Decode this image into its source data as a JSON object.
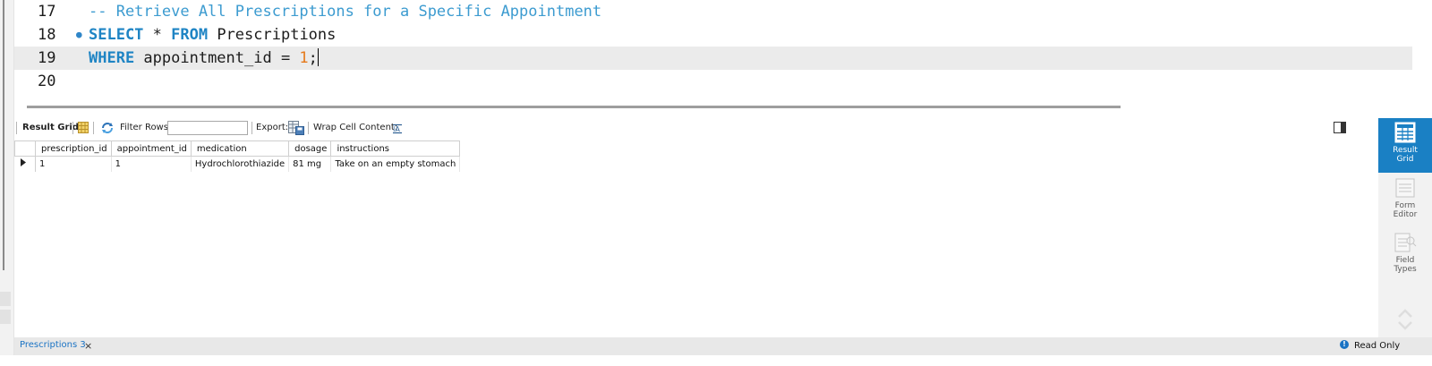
{
  "editor": {
    "lines": [
      {
        "number": "17",
        "comment": "-- Retrieve All Prescriptions for a Specific Appointment"
      },
      {
        "number": "18",
        "kw1": "SELECT",
        "star": " * ",
        "kw2": "FROM",
        "table": " Prescriptions"
      },
      {
        "number": "19",
        "kw": "WHERE",
        "rest": " appointment_id = ",
        "value": "1",
        "end": ";"
      },
      {
        "number": "20"
      }
    ]
  },
  "toolbar": {
    "result_grid_label": "Result Grid",
    "filter_rows_label": "Filter Rows:",
    "filter_value": "",
    "export_label": "Export:",
    "wrap_label": "Wrap Cell Content:"
  },
  "grid": {
    "columns": [
      "prescription_id",
      "appointment_id",
      "medication",
      "dosage",
      "instructions"
    ],
    "rows": [
      [
        "1",
        "1",
        "Hydrochlorothiazide",
        "81 mg",
        "Take on an empty stomach"
      ]
    ]
  },
  "right_panel": {
    "result_grid": [
      "Result",
      "Grid"
    ],
    "form_editor": [
      "Form",
      "Editor"
    ],
    "field_types": [
      "Field",
      "Types"
    ]
  },
  "bottom": {
    "tab_label": "Prescriptions 3",
    "read_only": "Read Only"
  },
  "colors": {
    "accent": "#1a80c4",
    "keyword": "#1e84c4",
    "comment": "#3c9bd0",
    "number": "#e5791b"
  }
}
